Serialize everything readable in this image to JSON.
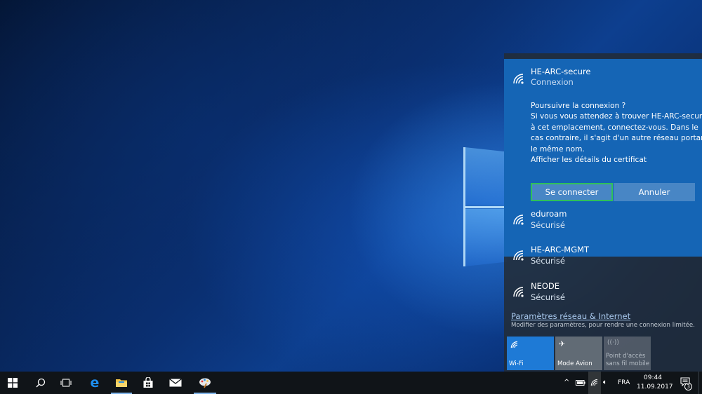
{
  "flyout": {
    "connecting_network": {
      "name": "HE-ARC-secure",
      "status": "Connexion",
      "message_lines": [
        "Poursuivre la connexion ?",
        "Si vous vous attendez à trouver HE-ARC-secure",
        "à cet emplacement, connectez-vous. Dans le",
        "cas contraire, il s'agit d'un autre réseau portant",
        "le même nom.",
        "Afficher les détails du certificat"
      ],
      "connect_label": "Se connecter",
      "cancel_label": "Annuler"
    },
    "networks": [
      {
        "name": "eduroam",
        "status": "Sécurisé"
      },
      {
        "name": "HE-ARC-MGMT",
        "status": "Sécurisé"
      },
      {
        "name": "NEODE",
        "status": "Sécurisé"
      }
    ],
    "settings_link": "Paramètres réseau & Internet",
    "settings_desc": "Modifier des paramètres, pour rendre une connexion limitée.",
    "tiles": {
      "wifi": "Wi-Fi",
      "airplane": "Mode Avion",
      "hotspot_line1": "Point d'accès",
      "hotspot_line2": "sans fil mobile"
    }
  },
  "taskbar": {
    "language": "FRA",
    "time": "09:44",
    "date": "11.09.2017",
    "notification_count": "3"
  },
  "colors": {
    "accent": "#1565b5",
    "connect_border": "#2fc15a",
    "taskbar": "#101418"
  }
}
